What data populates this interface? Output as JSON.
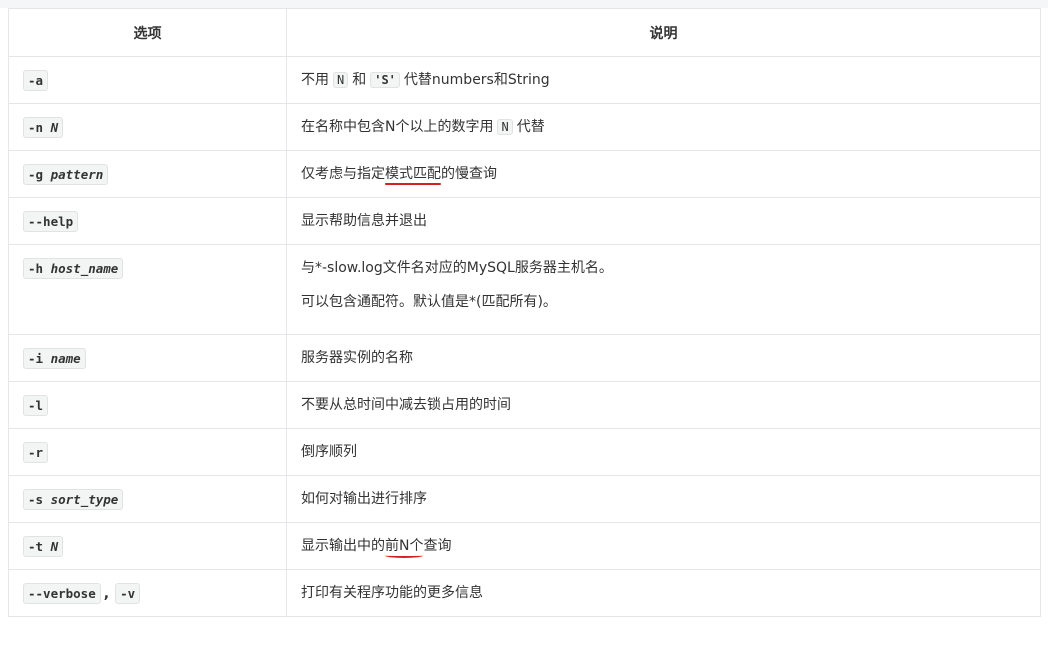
{
  "header": {
    "col_option": "选项",
    "col_desc": "说明"
  },
  "rows": [
    {
      "flag": "-a",
      "desc_pre": "不用",
      "code1": "N",
      "desc_mid": "和",
      "code2": "'S'",
      "desc_post": "代替numbers和String"
    },
    {
      "flag": "-n",
      "arg": "N",
      "desc_pre": "在名称中包含N个以上的数字用",
      "code1": "N",
      "desc_post": "代替"
    },
    {
      "flag": "-g",
      "arg": "pattern",
      "desc_pre": "仅考虑与指定",
      "desc_ul": "模式匹配",
      "desc_post": "的慢查询"
    },
    {
      "flag": "--help",
      "desc": "显示帮助信息并退出"
    },
    {
      "flag": "-h",
      "arg": "host_name",
      "desc_line1": "与*-slow.log文件名对应的MySQL服务器主机名。",
      "desc_line2": "可以包含通配符。默认值是*(匹配所有)。"
    },
    {
      "flag": "-i",
      "arg": "name",
      "desc": "服务器实例的名称"
    },
    {
      "flag": "-l",
      "desc": "不要从总时间中减去锁占用的时间"
    },
    {
      "flag": "-r",
      "desc": "倒序顺列"
    },
    {
      "flag": "-s",
      "arg": "sort_type",
      "desc": "如何对输出进行排序"
    },
    {
      "flag": "-t",
      "arg": "N",
      "desc_pre": "显示输出中的",
      "desc_ul": "前N个",
      "desc_post": "查询"
    },
    {
      "flag": "--verbose",
      "sep": ",",
      "flag2": "-v",
      "desc": "打印有关程序功能的更多信息"
    }
  ],
  "colors": {
    "underline": "#d62020",
    "border": "#e4e6e9",
    "code_bg": "#f3f4f4"
  }
}
